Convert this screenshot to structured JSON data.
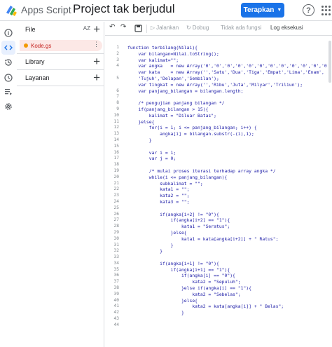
{
  "header": {
    "app_name": "Apps Script",
    "project_title": "Project tak berjudul",
    "deploy_label": "Terapkan",
    "help_label": "?"
  },
  "rail": {
    "icons": [
      "info-icon",
      "code-icon",
      "history-icon",
      "triggers-icon",
      "executions-icon",
      "settings-icon"
    ]
  },
  "panel": {
    "files_label": "File",
    "sort_label": "AZ",
    "file_name": "Kode.gs",
    "library_label": "Library",
    "services_label": "Layanan"
  },
  "toolbar": {
    "run_label": "Jalankan",
    "debug_label": "Dobug",
    "function_label": "Tidak ada fungsi",
    "log_label": "Log eksekusi"
  },
  "colors": {
    "accent": "#1a73e8",
    "file_highlight": "#fce8e6",
    "code_text": "#1a1aa6"
  },
  "editor": {
    "line_numbers": [
      "1",
      "2",
      "3",
      "4",
      "",
      "5",
      "",
      "6",
      "7",
      "8",
      "9",
      "10",
      "11",
      "12",
      "13",
      "14",
      "15",
      "16",
      "17",
      "18",
      "19",
      "20",
      "21",
      "22",
      "23",
      "24",
      "25",
      "26",
      "27",
      "28",
      "29",
      "30",
      "31",
      "32",
      "33",
      "34",
      "35",
      "36",
      "37",
      "38",
      "39",
      "40",
      "41",
      "42",
      "43",
      "44"
    ],
    "lines": [
      "function terbilang(Nilai){",
      "    var bilangan=Nilai.toString();",
      "    var kalimat=\"\";",
      "    var angka   = new Array('0','0','0','0','0','0','0','0','0','0','0','0','0','0','0','0');",
      "    var kata    = new Array('','Satu','Dua','Tiga','Empat','Lima','Enam',",
      "    'Tujuh','Delapan','Sembilan');",
      "    var tingkat = new Array('','Ribu','Juta','Milyar','Triliun');",
      "    var panjang_bilangan = bilangan.length;",
      "",
      "    /* pengujian panjang bilangan */",
      "    if(panjang_bilangan > 15){",
      "        kalimat = \"Diluar Batas\";",
      "    }else{",
      "        for(i = 1; i <= panjang_bilangan; i++) {",
      "            angka[i] = bilangan.substr(-(i),1);",
      "        }",
      "",
      "        var i = 1;",
      "        var j = 0;",
      "",
      "        /* mulai proses iterasi terhadap array angka */",
      "        while(i <= panjang_bilangan){",
      "            subkalimat = \"\";",
      "            kata1 = \"\";",
      "            kata2 = \"\";",
      "            kata3 = \"\";",
      "",
      "            if(angka[i+2] != \"0\"){",
      "                if(angka[i+2] == \"1\"){",
      "                    kata1 = \"Seratus\";",
      "                }else{",
      "                    kata1 = kata[angka[i+2]] + \" Ratus\";",
      "                }",
      "            }",
      "",
      "            if(angka[i+1] != \"0\"){",
      "                if(angka[i+1] == \"1\"){",
      "                    if(angka[i] == \"0\"){",
      "                        kata2 = \"Sepuluh\";",
      "                    }else if(angka[i] == \"1\"){",
      "                        kata2 = \"Sebelas\";",
      "                    }else{",
      "                        kata2 = kata[angka[i]] + \" Belas\";",
      "                    }"
    ]
  }
}
